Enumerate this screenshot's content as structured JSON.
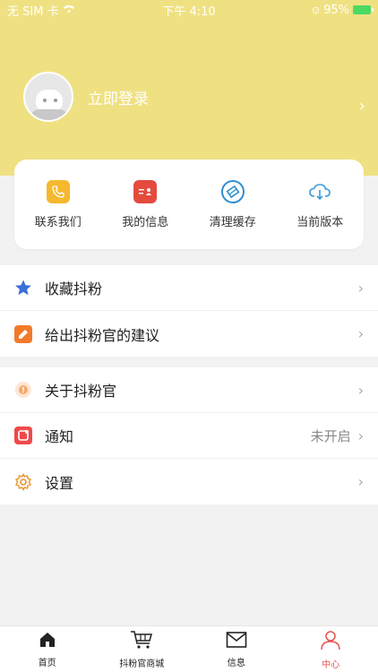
{
  "status": {
    "carrier": "无 SIM 卡",
    "time": "下午 4:10",
    "battery": "95%"
  },
  "profile": {
    "login_text": "立即登录"
  },
  "quick_actions": [
    {
      "label": "联系我们",
      "icon": "phone-icon",
      "color": "#f5b82e"
    },
    {
      "label": "我的信息",
      "icon": "id-card-icon",
      "color": "#e44a3d"
    },
    {
      "label": "清理缓存",
      "icon": "broom-icon",
      "color": "#2f8fd0"
    },
    {
      "label": "当前版本",
      "icon": "cloud-download-icon",
      "color": "#3a9ad9"
    }
  ],
  "menu_group1": [
    {
      "label": "收藏抖粉",
      "icon": "star-icon"
    },
    {
      "label": "给出抖粉官的建议",
      "icon": "feedback-icon"
    }
  ],
  "menu_group2": [
    {
      "label": "关于抖粉官",
      "icon": "info-icon",
      "value": ""
    },
    {
      "label": "通知",
      "icon": "notification-icon",
      "value": "未开启"
    },
    {
      "label": "设置",
      "icon": "gear-icon",
      "value": ""
    }
  ],
  "tabs": [
    {
      "label": "首页",
      "icon": "home-icon"
    },
    {
      "label": "抖粉官商城",
      "icon": "cart-icon"
    },
    {
      "label": "信息",
      "icon": "mail-icon"
    },
    {
      "label": "中心",
      "icon": "user-icon",
      "active": true
    }
  ],
  "colors": {
    "header": "#efe182",
    "accent": "#e4524f"
  }
}
